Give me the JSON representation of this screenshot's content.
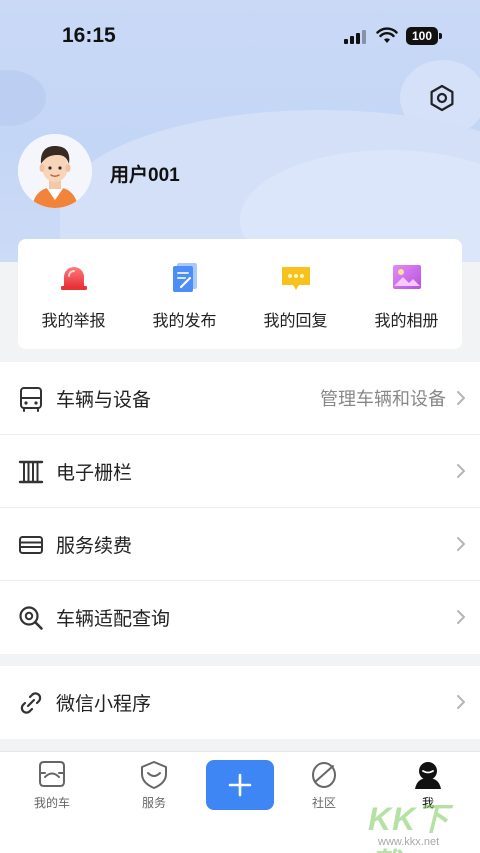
{
  "status_bar": {
    "time": "16:15",
    "battery": "100"
  },
  "profile": {
    "username": "用户001"
  },
  "quick_actions": [
    {
      "label": "我的举报",
      "icon": "report-icon",
      "color": "#f04848"
    },
    {
      "label": "我的发布",
      "icon": "publish-icon",
      "color": "#4c8df6"
    },
    {
      "label": "我的回复",
      "icon": "reply-icon",
      "color": "#f8c21c"
    },
    {
      "label": "我的相册",
      "icon": "album-icon",
      "color": "#c070e8"
    }
  ],
  "menu_group1": [
    {
      "label": "车辆与设备",
      "extra": "管理车辆和设备",
      "icon": "vehicle-icon"
    },
    {
      "label": "电子栅栏",
      "extra": "",
      "icon": "fence-icon"
    },
    {
      "label": "服务续费",
      "extra": "",
      "icon": "card-icon"
    },
    {
      "label": "车辆适配查询",
      "extra": "",
      "icon": "search-icon"
    }
  ],
  "menu_group2": [
    {
      "label": "微信小程序",
      "extra": "",
      "icon": "link-icon"
    }
  ],
  "tabbar": {
    "items": [
      {
        "label": "我的车",
        "icon": "car-icon"
      },
      {
        "label": "服务",
        "icon": "service-icon"
      },
      {
        "label": "社区",
        "icon": "community-icon"
      },
      {
        "label": "我",
        "icon": "me-icon"
      }
    ],
    "plus_icon": "plus-icon"
  },
  "watermark": {
    "text": "KK下载",
    "url": "www.kkx.net"
  },
  "colors": {
    "accent": "#3d86f4",
    "hero": "#c9d9f6"
  }
}
